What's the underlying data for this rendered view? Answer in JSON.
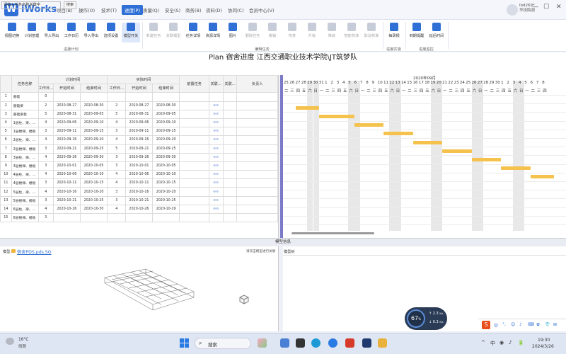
{
  "app": {
    "name": "iWorks",
    "logo": "W"
  },
  "menus": [
    "项目(B)",
    "操作(O)",
    "技术(T)",
    "进度(P)",
    "质量(Q)",
    "安全(S)",
    "商务(B)",
    "资料(D)",
    "协同(C)",
    "会员中心(V)"
  ],
  "user": {
    "name": "lbd269*",
    "role": "华设院测"
  },
  "window": {
    "minimize": "—",
    "maximize": "☐",
    "close": "✕"
  },
  "ribbon": {
    "groups": [
      {
        "label": "进度计划",
        "buttons": [
          "视图切换",
          "计划管理",
          "导入导出",
          "工作日历",
          "导入导出",
          "选项设置",
          "模型开关"
        ]
      },
      {
        "label": "编辑任务",
        "buttons": [
          "新建任务",
          "关联模型",
          "任务详情",
          "资源详情",
          "图片",
          "删除任务",
          "撤销",
          "恢复",
          "升级",
          "降级",
          "智能校准",
          "取消校准"
        ]
      },
      {
        "label": "进度实施",
        "buttons": [
          "每录报"
        ]
      },
      {
        "label": "进度监控",
        "buttons": [
          "到期提醒",
          "延后时间"
        ]
      }
    ]
  },
  "plan_title": "Plan 宿舍进度 江西交通职业技术学院\\JT筑梦队",
  "search": {
    "placeholder": "请输入任务名称关键字",
    "button": "搜索"
  },
  "grid": {
    "headers": {
      "task_name": "任务名称",
      "plan_time": "计划时间",
      "actual_time": "实际时间",
      "workdays": "工作日...",
      "start": "开始时间",
      "end": "结束时间",
      "predecessor": "前置任务",
      "link1": "关联...",
      "link2": "关联...",
      "owner": "负责人"
    },
    "rows": [
      {
        "no": "1",
        "name": "基础",
        "pd": "0",
        "ps": "",
        "pe": "",
        "ad": "",
        "as": "",
        "ae": "",
        "link": ""
      },
      {
        "no": "2",
        "name": "基础梁",
        "pd": "2",
        "ps": "2020-08-27",
        "pe": "2020-08-30",
        "ad": "2",
        "as": "2020-08-27",
        "ae": "2020-08-30",
        "link": "⊖⊖"
      },
      {
        "no": "3",
        "name": "基础梁板",
        "pd": "5",
        "ps": "2020-08-31",
        "pe": "2020-09-05",
        "ad": "5",
        "as": "2020-08-31",
        "ae": "2020-09-05",
        "link": "⊖⊖"
      },
      {
        "no": "4",
        "name": "1层柱、梁、...",
        "pd": "4",
        "ps": "2020-09-06",
        "pe": "2020-09-10",
        "ad": "4",
        "as": "2020-09-06",
        "ae": "2020-09-10",
        "link": "⊖⊖"
      },
      {
        "no": "5",
        "name": "1层楼梯、楼板",
        "pd": "3",
        "ps": "2020-09-11",
        "pe": "2020-09-15",
        "ad": "3",
        "as": "2020-09-11",
        "ae": "2020-09-15",
        "link": "⊖⊖"
      },
      {
        "no": "6",
        "name": "2层柱、梁、...",
        "pd": "4",
        "ps": "2020-09-16",
        "pe": "2020-09-20",
        "ad": "4",
        "as": "2020-09-16",
        "ae": "2020-09-20",
        "link": "⊖⊖"
      },
      {
        "no": "7",
        "name": "2层楼梯、楼板",
        "pd": "3",
        "ps": "2020-09-21",
        "pe": "2020-09-25",
        "ad": "5",
        "as": "2020-09-21",
        "ae": "2020-09-25",
        "link": "⊖⊖"
      },
      {
        "no": "8",
        "name": "3层柱、梁、...",
        "pd": "4",
        "ps": "2020-09-26",
        "pe": "2020-09-30",
        "ad": "3",
        "as": "2020-09-26",
        "ae": "2020-09-30",
        "link": "⊖⊖"
      },
      {
        "no": "9",
        "name": "3层楼梯、楼板",
        "pd": "3",
        "ps": "2020-10-01",
        "pe": "2020-10-05",
        "ad": "3",
        "as": "2020-10-01",
        "ae": "2020-10-05",
        "link": "⊖⊖"
      },
      {
        "no": "10",
        "name": "4层柱、梁、...",
        "pd": "4",
        "ps": "2020-10-06",
        "pe": "2020-10-10",
        "ad": "4",
        "as": "2020-10-06",
        "ae": "2020-10-10",
        "link": "⊖⊖"
      },
      {
        "no": "11",
        "name": "4层楼梯、楼板",
        "pd": "3",
        "ps": "2020-10-11",
        "pe": "2020-10-15",
        "ad": "4",
        "as": "2020-10-11",
        "ae": "2020-10-15",
        "link": "⊖⊖"
      },
      {
        "no": "12",
        "name": "5层柱、梁、...",
        "pd": "4",
        "ps": "2020-10-16",
        "pe": "2020-10-20",
        "ad": "3",
        "as": "2020-10-16",
        "ae": "2020-10-20",
        "link": "⊖⊖"
      },
      {
        "no": "13",
        "name": "5层楼梯、楼板",
        "pd": "3",
        "ps": "2020-10-21",
        "pe": "2020-10-25",
        "ad": "3",
        "as": "2020-10-21",
        "ae": "2020-10-25",
        "link": "⊖⊖"
      },
      {
        "no": "14",
        "name": "6层柱、梁、...",
        "pd": "4",
        "ps": "2020-10-26",
        "pe": "2020-10-30",
        "ad": "4",
        "as": "2020-10-26",
        "ae": "2020-10-29",
        "link": "⊖⊖"
      },
      {
        "no": "15",
        "name": "6层楼梯、楼板",
        "pd": "3",
        "ps": "",
        "pe": "",
        "ad": "",
        "as": "",
        "ae": "",
        "link": ""
      }
    ]
  },
  "gantt": {
    "month": "2020年09月",
    "days": [
      "25",
      "26",
      "27",
      "28",
      "29",
      "30",
      "31",
      "1",
      "2",
      "3",
      "4",
      "5",
      "6",
      "7",
      "8",
      "9",
      "10",
      "11",
      "12",
      "13",
      "14",
      "15",
      "16",
      "17",
      "18",
      "19",
      "20",
      "21",
      "22",
      "23",
      "24",
      "25",
      "26",
      "27",
      "28",
      "29",
      "30",
      "1",
      "2",
      "3",
      "4",
      "5",
      "6",
      "7",
      "8"
    ],
    "weekdays": [
      "二",
      "三",
      "四",
      "五",
      "六",
      "日",
      "一",
      "二",
      "三",
      "四",
      "五",
      "六",
      "日",
      "一",
      "二",
      "三",
      "四",
      "五",
      "六",
      "日",
      "一",
      "二",
      "三",
      "四",
      "五",
      "六",
      "日",
      "一",
      "二",
      "三",
      "四",
      "五",
      "六",
      "日",
      "一",
      "二",
      "三",
      "四",
      "五",
      "六",
      "日",
      "一",
      "二",
      "三",
      "四"
    ],
    "bars": [
      {
        "row": 1,
        "start": 2,
        "end": 6
      },
      {
        "row": 2,
        "start": 6,
        "end": 12
      },
      {
        "row": 3,
        "start": 12,
        "end": 17
      },
      {
        "row": 4,
        "start": 17,
        "end": 22
      },
      {
        "row": 5,
        "start": 22,
        "end": 27
      },
      {
        "row": 6,
        "start": 27,
        "end": 32
      },
      {
        "row": 7,
        "start": 32,
        "end": 37
      },
      {
        "row": 8,
        "start": 37,
        "end": 42
      },
      {
        "row": 9,
        "start": 42,
        "end": 46
      }
    ]
  },
  "model_info": {
    "bar_title": "模型信息",
    "model_label": "模型:",
    "model_file": "宿舍PDS.pds.SG",
    "hint": "请双击模型进行关联",
    "tree_label": "模型树"
  },
  "widget": {
    "percent": "67",
    "percent_unit": "%",
    "up": "2.3",
    "down": "0.3",
    "up_unit": "K/s",
    "down_unit": "K/s"
  },
  "ime": {
    "logo": "S",
    "items": [
      "中",
      "°,",
      "☺",
      "♪",
      "⌨",
      "✿",
      "👕",
      "⊞"
    ]
  },
  "taskbar": {
    "weather_temp": "16°C",
    "weather_desc": "晴朗",
    "search": "搜索",
    "time": "19:30",
    "date": "2024/3/26",
    "sys_icons": [
      "^",
      "中",
      "◉",
      "♪",
      "🔋"
    ]
  }
}
